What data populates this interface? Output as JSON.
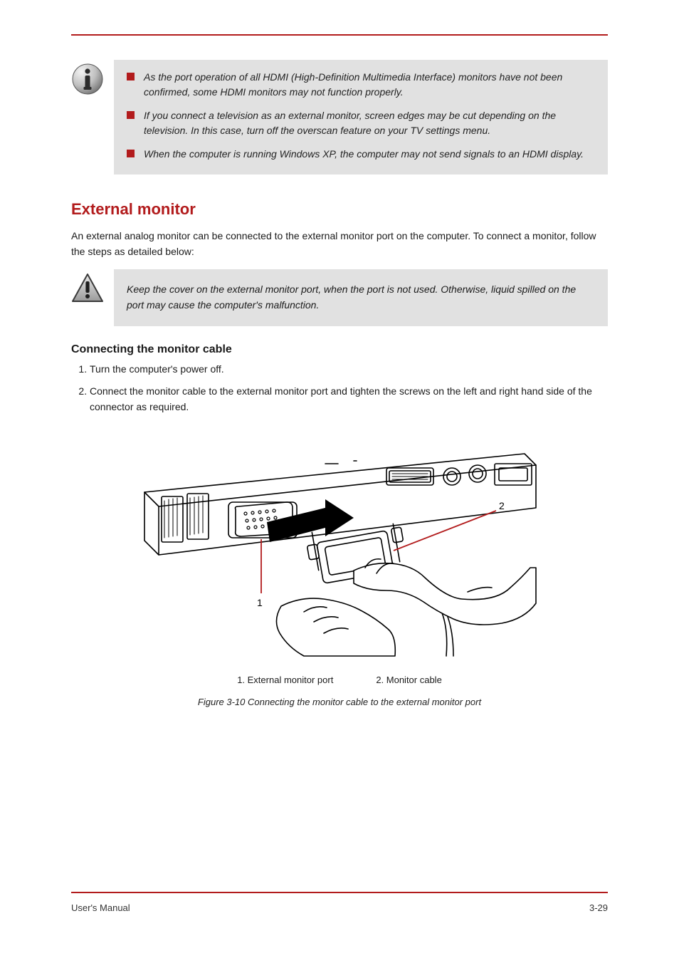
{
  "info_box": {
    "items": [
      "As the port operation of all HDMI (High-Definition Multimedia Interface) monitors have not been confirmed, some HDMI monitors may not function properly.",
      "If you connect a television as an external monitor, screen edges may be cut depending on the television. In this case, turn off the overscan feature on your TV settings menu.",
      "When the computer is running Windows XP, the computer may not send signals to an HDMI display."
    ]
  },
  "section": {
    "heading": "External monitor",
    "intro": "An external analog monitor can be connected to the external monitor port on the computer. To connect a monitor, follow the steps as detailed below:"
  },
  "caution_box": {
    "text": "Keep the cover on the external monitor port, when the port is not used. Otherwise, liquid spilled on the port may cause the computer's malfunction."
  },
  "subsection": {
    "heading": "Connecting the monitor cable",
    "steps": [
      "Turn the computer's power off.",
      "Connect the monitor cable to the external monitor port and tighten the screws on the left and right hand side of the connector as required."
    ]
  },
  "figure": {
    "caption": "Figure 3-10 Connecting the monitor cable to the external monitor port",
    "labels": {
      "port": "1. External monitor port",
      "cable": "2. Monitor cable"
    }
  },
  "footer": {
    "left": "User's Manual",
    "right": "3-29"
  }
}
